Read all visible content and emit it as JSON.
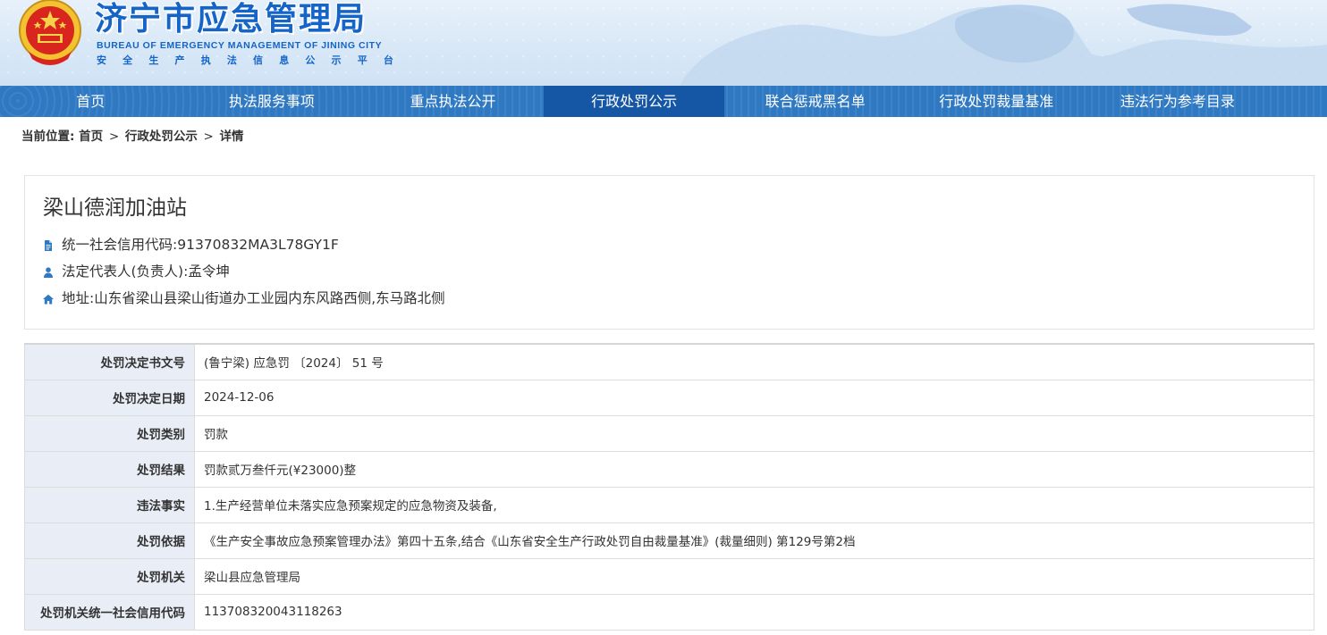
{
  "header": {
    "title_cn": "济宁市应急管理局",
    "title_en": "BUREAU OF EMERGENCY MANAGEMENT OF JINING CITY",
    "subtitle_chars": [
      "安",
      "全",
      "生",
      "产",
      "执",
      "法",
      "信",
      "息",
      "公",
      "示",
      "平",
      "台"
    ]
  },
  "nav": {
    "items": [
      {
        "label": "首页",
        "active": false
      },
      {
        "label": "执法服务事项",
        "active": false
      },
      {
        "label": "重点执法公开",
        "active": false
      },
      {
        "label": "行政处罚公示",
        "active": true
      },
      {
        "label": "联合惩戒黑名单",
        "active": false
      },
      {
        "label": "行政处罚裁量基准",
        "active": false
      },
      {
        "label": "违法行为参考目录",
        "active": false
      }
    ]
  },
  "breadcrumb": {
    "prefix": "当前位置:",
    "crumbs": [
      "首页",
      "行政处罚公示",
      "详情"
    ],
    "separator": ">"
  },
  "company": {
    "name": "梁山德润加油站",
    "credit_code": "统一社会信用代码:91370832MA3L78GY1F",
    "legal_rep": "法定代表人(负责人):孟令坤",
    "address": "地址:山东省梁山县梁山街道办工业园内东风路西侧,东马路北侧"
  },
  "details": {
    "rows": [
      {
        "label": "处罚决定书文号",
        "value": "(鲁宁梁) 应急罚 〔2024〕 51 号"
      },
      {
        "label": "处罚决定日期",
        "value": "2024-12-06"
      },
      {
        "label": "处罚类别",
        "value": "罚款"
      },
      {
        "label": "处罚结果",
        "value": "罚款贰万叁仟元(¥23000)整"
      },
      {
        "label": "违法事实",
        "value": "1.生产经营单位未落实应急预案规定的应急物资及装备,"
      },
      {
        "label": "处罚依据",
        "value": "《生产安全事故应急预案管理办法》第四十五条,结合《山东省安全生产行政处罚自由裁量基准》(裁量细则) 第129号第2档"
      },
      {
        "label": "处罚机关",
        "value": "梁山县应急管理局"
      },
      {
        "label": "处罚机关统一社会信用代码",
        "value": "113708320043118263"
      }
    ]
  },
  "colors": {
    "nav_bg": "#2f79c3",
    "nav_active": "#1557a4",
    "brand_blue": "#1565c8",
    "label_bg": "#e9eef6"
  }
}
